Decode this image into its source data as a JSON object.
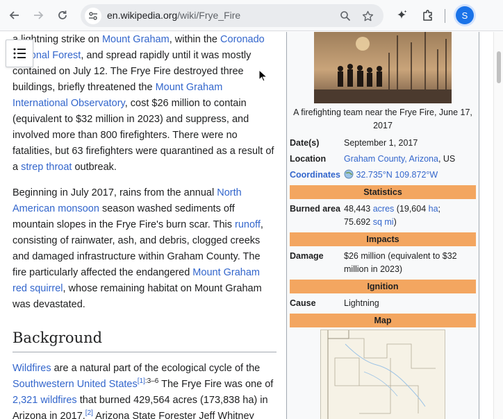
{
  "browser": {
    "url_host": "en.wikipedia.org",
    "url_path": "/wiki/Frye_Fire",
    "profile_initial": "S",
    "icons": [
      "back-icon",
      "forward-icon",
      "reload-icon",
      "site-info-icon",
      "zoom-icon",
      "bookmark-star-icon",
      "gemini-spark-icon",
      "extensions-icon"
    ]
  },
  "article": {
    "p1": {
      "t1": "a lightning strike on ",
      "l1": "Mount Graham",
      "t2": ", within the ",
      "l2": "Coronado National Forest",
      "t3": ", and spread rapidly until it was mostly contained on July 12. The Frye Fire destroyed three buildings, briefly threatened the ",
      "l3": "Mount Graham International Observatory",
      "t4": ", cost $26 million to contain (equivalent to $32 million in 2023) and suppress, and involved more than 800 firefighters. There were no fatalities, but 63 firefighters were quarantined as a result of a ",
      "l4": "strep throat",
      "t5": " outbreak."
    },
    "p2": {
      "t1": "Beginning in July 2017, rains from the annual ",
      "l1": "North American monsoon",
      "t2": " season washed sediments off mountain slopes in the Frye Fire's burn scar. This ",
      "l2": "runoff",
      "t3": ", consisting of rainwater, ash, and debris, clogged creeks and damaged infrastructure within Graham County. The fire particularly affected the endangered ",
      "l3": "Mount Graham red squirrel",
      "t4": ", whose remaining habitat on Mount Graham was devastated."
    },
    "heading_background": "Background",
    "p3": {
      "l1": "Wildfires",
      "t1": " are a natural part of the ecological cycle of the ",
      "l2": "Southwestern United States",
      "ref1": "[1]",
      "ref1_pages": ":3–6",
      "t2": " The Frye Fire was one of ",
      "l3": "2,321 wildfires",
      "t3": " that burned 429,564 acres (173,838 ha) in Arizona in 2017.",
      "ref2": "[2]",
      "t4": " Arizona State Forester Jeff Whitney"
    }
  },
  "infobox": {
    "caption": "A firefighting team near the Frye Fire, June 17, 2017",
    "date_label": "Date(s)",
    "date_value": "September 1, 2017",
    "location_label": "Location",
    "location_link": "Graham County, Arizona",
    "location_suffix": ", US",
    "coords_label": "Coordinates",
    "coords_value": "32.735°N 109.872°W",
    "statistics": "Statistics",
    "burned_label": "Burned area",
    "burned_1": "48,443 ",
    "burned_acres": "acres",
    "burned_2": " (19,604 ",
    "burned_ha": "ha",
    "burned_3": ";",
    "burned_4": "75.692 ",
    "burned_sqmi": "sq mi",
    "burned_5": ")",
    "impacts": "Impacts",
    "damage_label": "Damage",
    "damage_value": "$26 million (equivalent to $32 million in 2023)",
    "ignition": "Ignition",
    "cause_label": "Cause",
    "cause_value": "Lightning",
    "map": "Map"
  },
  "colors": {
    "link": "#3366cc",
    "infobox_header": "#f3a660",
    "profile": "#1a73e8"
  }
}
